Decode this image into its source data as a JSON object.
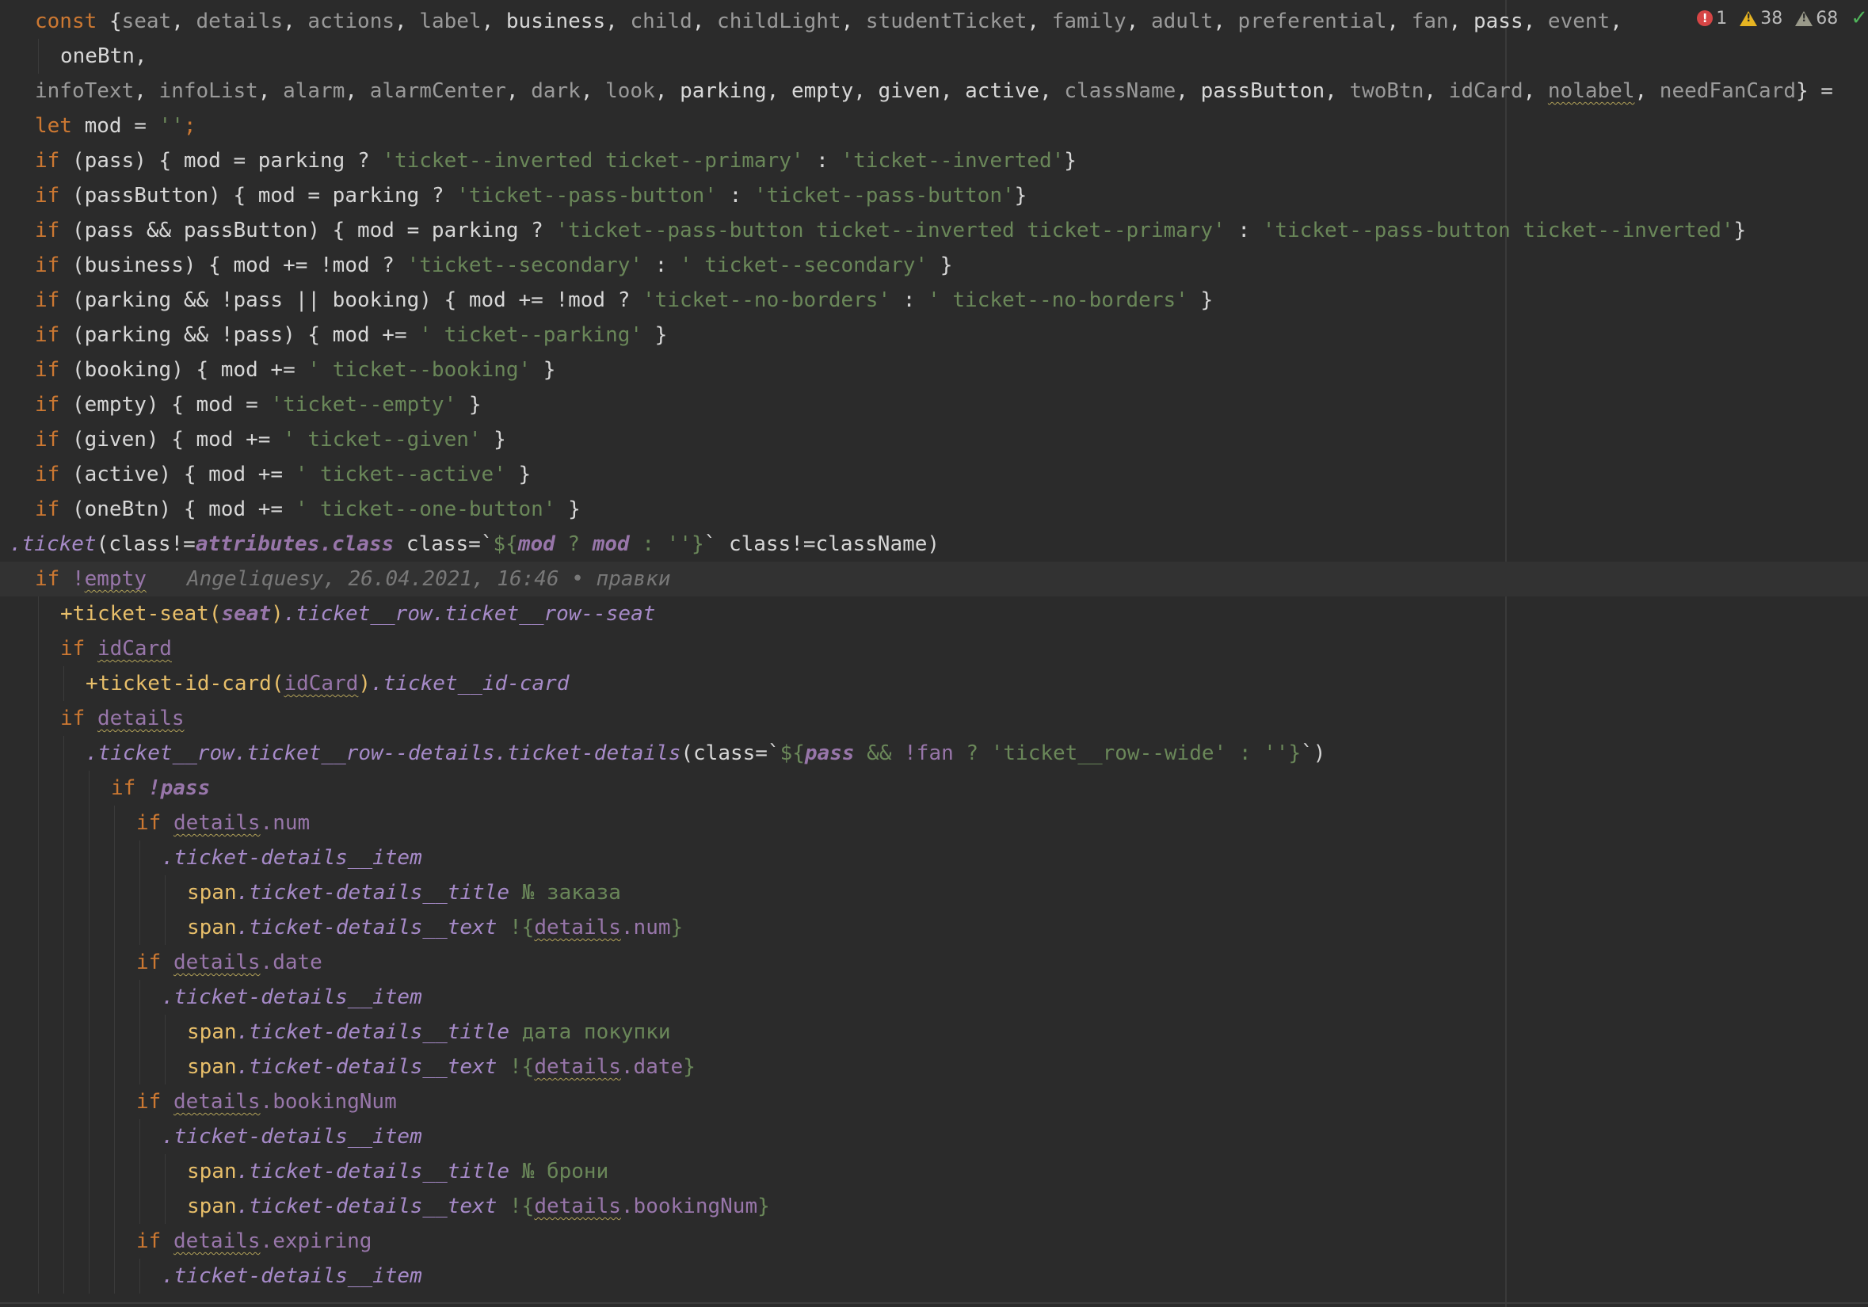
{
  "inspection": {
    "errors": "1",
    "warnings": "38",
    "weak_warnings": "68",
    "status_icon": "check-icon"
  },
  "blame": "Angeliquesy, 26.04.2021, 16:46 • правки",
  "code": {
    "l1_kw": "const",
    "l1": [
      [
        "{",
        "wht"
      ],
      [
        "seat",
        "gray"
      ],
      [
        ", ",
        "wht"
      ],
      [
        "details",
        "gray"
      ],
      [
        ", ",
        "wht"
      ],
      [
        "actions",
        "gray"
      ],
      [
        ", ",
        "wht"
      ],
      [
        "label",
        "gray"
      ],
      [
        ", ",
        "wht"
      ],
      [
        "business",
        "wht"
      ],
      [
        ", ",
        "wht"
      ],
      [
        "child",
        "gray"
      ],
      [
        ", ",
        "wht"
      ],
      [
        "childLight",
        "gray"
      ],
      [
        ", ",
        "wht"
      ],
      [
        "studentTicket",
        "gray"
      ],
      [
        ", ",
        "wht"
      ],
      [
        "family",
        "gray"
      ],
      [
        ", ",
        "wht"
      ],
      [
        "adult",
        "gray"
      ],
      [
        ", ",
        "wht"
      ],
      [
        "preferential",
        "gray"
      ],
      [
        ", ",
        "wht"
      ],
      [
        "fan",
        "gray"
      ],
      [
        ", ",
        "wht"
      ],
      [
        "pass",
        "wht"
      ],
      [
        ", ",
        "wht"
      ],
      [
        "event",
        "gray"
      ],
      [
        ",",
        "wht"
      ]
    ],
    "l2": "oneBtn,",
    "l3": [
      [
        "infoText",
        "gray"
      ],
      [
        ", ",
        "wht"
      ],
      [
        "infoList",
        "gray"
      ],
      [
        ", ",
        "wht"
      ],
      [
        "alarm",
        "gray"
      ],
      [
        ", ",
        "wht"
      ],
      [
        "alarmCenter",
        "gray"
      ],
      [
        ", ",
        "wht"
      ],
      [
        "dark",
        "gray"
      ],
      [
        ", ",
        "wht"
      ],
      [
        "look",
        "gray"
      ],
      [
        ", ",
        "wht"
      ],
      [
        "parking",
        "wht"
      ],
      [
        ", ",
        "wht"
      ],
      [
        "empty",
        "wht"
      ],
      [
        ", ",
        "wht"
      ],
      [
        "given",
        "wht"
      ],
      [
        ", ",
        "wht"
      ],
      [
        "active",
        "wht"
      ],
      [
        ", ",
        "wht"
      ],
      [
        "className",
        "gray"
      ],
      [
        ", ",
        "wht"
      ],
      [
        "passButton",
        "wht"
      ],
      [
        ", ",
        "wht"
      ],
      [
        "twoBtn",
        "gray"
      ],
      [
        ", ",
        "wht"
      ],
      [
        "idCard",
        "gray"
      ],
      [
        ", ",
        "wht"
      ],
      [
        "nolabel",
        "gray wavy"
      ],
      [
        ", ",
        "wht"
      ],
      [
        "needFanCard",
        "gray"
      ],
      [
        "} =",
        "wht"
      ]
    ],
    "l4": [
      [
        "let",
        "kw"
      ],
      [
        " mod = ",
        "wht"
      ],
      [
        "''",
        "str"
      ],
      [
        ";",
        "kw"
      ]
    ],
    "ifs": [
      [
        [
          "if",
          "kw"
        ],
        [
          " (pass) { mod = parking ? ",
          "wht"
        ],
        [
          "'ticket--inverted ticket--primary'",
          "str"
        ],
        [
          " : ",
          "wht"
        ],
        [
          "'ticket--inverted'",
          "str"
        ],
        [
          "}",
          "wht"
        ]
      ],
      [
        [
          "if",
          "kw"
        ],
        [
          " (passButton) { mod = parking ? ",
          "wht"
        ],
        [
          "'ticket--pass-button'",
          "str"
        ],
        [
          " : ",
          "wht"
        ],
        [
          "'ticket--pass-button'",
          "str"
        ],
        [
          "}",
          "wht"
        ]
      ],
      [
        [
          "if",
          "kw"
        ],
        [
          " (pass && passButton) { mod = parking ? ",
          "wht"
        ],
        [
          "'ticket--pass-button ticket--inverted ticket--primary'",
          "str"
        ],
        [
          " : ",
          "wht"
        ],
        [
          "'ticket--pass-button ticket--inverted'",
          "str"
        ],
        [
          "}",
          "wht"
        ]
      ],
      [
        [
          "if",
          "kw"
        ],
        [
          " (business) { mod += !mod ? ",
          "wht"
        ],
        [
          "'ticket--secondary'",
          "str"
        ],
        [
          " : ",
          "wht"
        ],
        [
          "' ticket--secondary'",
          "str"
        ],
        [
          " }",
          "wht"
        ]
      ],
      [
        [
          "if",
          "kw"
        ],
        [
          " (parking && !pass || booking) { mod += !mod ? ",
          "wht"
        ],
        [
          "'ticket--no-borders'",
          "str"
        ],
        [
          " : ",
          "wht"
        ],
        [
          "' ticket--no-borders'",
          "str"
        ],
        [
          " }",
          "wht"
        ]
      ],
      [
        [
          "if",
          "kw"
        ],
        [
          " (parking && !pass) { mod += ",
          "wht"
        ],
        [
          "' ticket--parking'",
          "str"
        ],
        [
          " }",
          "wht"
        ]
      ],
      [
        [
          "if",
          "kw"
        ],
        [
          " (booking) { mod += ",
          "wht"
        ],
        [
          "' ticket--booking'",
          "str"
        ],
        [
          " }",
          "wht"
        ]
      ],
      [
        [
          "if",
          "kw"
        ],
        [
          " (empty) { mod = ",
          "wht"
        ],
        [
          "'ticket--empty'",
          "str"
        ],
        [
          " }",
          "wht"
        ]
      ],
      [
        [
          "if",
          "kw"
        ],
        [
          " (given) { mod += ",
          "wht"
        ],
        [
          "' ticket--given'",
          "str"
        ],
        [
          " }",
          "wht"
        ]
      ],
      [
        [
          "if",
          "kw"
        ],
        [
          " (active) { mod += ",
          "wht"
        ],
        [
          "' ticket--active'",
          "str"
        ],
        [
          " }",
          "wht"
        ]
      ],
      [
        [
          "if",
          "kw"
        ],
        [
          " (oneBtn) { mod += ",
          "wht"
        ],
        [
          "' ticket--one-button'",
          "str"
        ],
        [
          " }",
          "wht"
        ]
      ]
    ],
    "l16": [
      [
        ".ticket",
        "it"
      ],
      [
        "(class!=",
        "wht"
      ],
      [
        "attributes.class",
        "purpb"
      ],
      [
        " class=`",
        "wht"
      ],
      [
        "${",
        "str"
      ],
      [
        "mod",
        "purpb"
      ],
      [
        " ? ",
        "str"
      ],
      [
        "mod",
        "purpb"
      ],
      [
        " : ''}",
        "str"
      ],
      [
        "` class!=className)",
        "wht"
      ]
    ],
    "l17": [
      [
        "if ",
        "kw"
      ],
      [
        "!",
        "purp"
      ],
      [
        "empty",
        "purp wavy"
      ]
    ],
    "l18": [
      [
        "+ticket-seat(",
        "ytag"
      ],
      [
        "seat",
        "purpb"
      ],
      [
        ")",
        "ytag"
      ],
      [
        ".ticket__row.ticket__row--seat",
        "it"
      ]
    ],
    "l19": [
      [
        "if ",
        "kw"
      ],
      [
        "idCard",
        "purp wavy"
      ]
    ],
    "l20": [
      [
        "+ticket-id-card(",
        "ytag"
      ],
      [
        "idCard",
        "purp wavy"
      ],
      [
        ")",
        "ytag"
      ],
      [
        ".ticket__id-card",
        "it"
      ]
    ],
    "l21": [
      [
        "if ",
        "kw"
      ],
      [
        "details",
        "purp wavy"
      ]
    ],
    "l22": [
      [
        ".ticket__row.ticket__row--details.ticket-details",
        "it"
      ],
      [
        "(class=`",
        "wht"
      ],
      [
        "${",
        "str"
      ],
      [
        "pass",
        "purpb"
      ],
      [
        " && ",
        "str"
      ],
      [
        "!fan",
        "purp"
      ],
      [
        " ? ",
        "str"
      ],
      [
        "'ticket__row--wide'",
        "str"
      ],
      [
        " : ''}",
        "str"
      ],
      [
        "`)",
        "wht"
      ]
    ],
    "l23": [
      [
        "if ",
        "kw"
      ],
      [
        "!pass",
        "purpb"
      ]
    ],
    "l24": [
      [
        "if ",
        "kw"
      ],
      [
        "details",
        "purp wavy"
      ],
      [
        ".num",
        "purp"
      ]
    ],
    "l25": [
      [
        ".ticket-details__item",
        "it"
      ]
    ],
    "l26": [
      [
        "span",
        "ytag"
      ],
      [
        ".ticket-details__title",
        "it"
      ],
      [
        " № заказа",
        "str"
      ]
    ],
    "l27": [
      [
        "span",
        "ytag"
      ],
      [
        ".ticket-details__text",
        "it"
      ],
      [
        " !{",
        "str"
      ],
      [
        "details",
        "purp wavy"
      ],
      [
        ".num",
        "purp"
      ],
      [
        "}",
        "str"
      ]
    ],
    "l28": [
      [
        "if ",
        "kw"
      ],
      [
        "details",
        "purp wavy"
      ],
      [
        ".date",
        "purp"
      ]
    ],
    "l29": [
      [
        ".ticket-details__item",
        "it"
      ]
    ],
    "l30": [
      [
        "span",
        "ytag"
      ],
      [
        ".ticket-details__title",
        "it"
      ],
      [
        " дата покупки",
        "str"
      ]
    ],
    "l31": [
      [
        "span",
        "ytag"
      ],
      [
        ".ticket-details__text",
        "it"
      ],
      [
        " !{",
        "str"
      ],
      [
        "details",
        "purp wavy"
      ],
      [
        ".date",
        "purp"
      ],
      [
        "}",
        "str"
      ]
    ],
    "l32": [
      [
        "if ",
        "kw"
      ],
      [
        "details",
        "purp wavy"
      ],
      [
        ".bookingNum",
        "purp"
      ]
    ],
    "l33": [
      [
        ".ticket-details__item",
        "it"
      ]
    ],
    "l34": [
      [
        "span",
        "ytag"
      ],
      [
        ".ticket-details__title",
        "it"
      ],
      [
        " № брони",
        "str"
      ]
    ],
    "l35": [
      [
        "span",
        "ytag"
      ],
      [
        ".ticket-details__text",
        "it"
      ],
      [
        " !{",
        "str"
      ],
      [
        "details",
        "purp wavy"
      ],
      [
        ".bookingNum",
        "purp"
      ],
      [
        "}",
        "str"
      ]
    ],
    "l36": [
      [
        "if ",
        "kw"
      ],
      [
        "details",
        "purp wavy"
      ],
      [
        ".expiring",
        "purp"
      ]
    ],
    "l37": [
      [
        ".ticket-details__item",
        "it"
      ]
    ]
  }
}
